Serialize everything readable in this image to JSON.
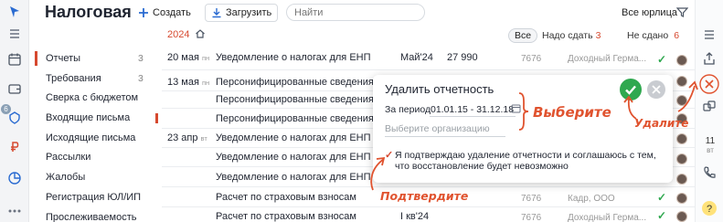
{
  "app": {
    "title": "Налоговая"
  },
  "header": {
    "create_label": "Создать",
    "upload_label": "Загрузить",
    "search_placeholder": "Найти",
    "filter_label": "Все юрлица",
    "corner_text": "ГС"
  },
  "toolbar2": {
    "year": "2024",
    "tab_all": "Все",
    "tab_todo": "Надо сдать",
    "tab_todo_count": "3",
    "tab_notdone": "Не сдано",
    "tab_notdone_count": "6"
  },
  "rail": {
    "badge": "6"
  },
  "sidebar": {
    "items": [
      {
        "label": "Отчеты",
        "count": "3"
      },
      {
        "label": "Требования",
        "count": "3"
      },
      {
        "label": "Сверка с бюджетом",
        "count": ""
      },
      {
        "label": "Входящие письма",
        "count": ""
      },
      {
        "label": "Исходящие письма",
        "count": ""
      },
      {
        "label": "Рассылки",
        "count": ""
      },
      {
        "label": "Жалобы",
        "count": ""
      },
      {
        "label": "Регистрация ЮЛ/ИП",
        "count": ""
      },
      {
        "label": "Прослеживаемость",
        "count": ""
      }
    ]
  },
  "table": {
    "rows": [
      {
        "date": "20 мая",
        "weekday": "пн",
        "name": "Уведомление о налогах для ЕНП",
        "period": "Май'24",
        "amount": "27 990",
        "code": "7676",
        "org": "Доходный Герма..."
      },
      {
        "date": "13 мая",
        "weekday": "пн",
        "name": "Персонифицированные сведения",
        "period": "",
        "amount": "",
        "code": "",
        "org": ""
      },
      {
        "date": "",
        "weekday": "",
        "name": "Персонифицированные сведения",
        "period": "",
        "amount": "",
        "code": "",
        "org": ""
      },
      {
        "date": "",
        "weekday": "",
        "name": "Персонифицированные сведения",
        "period": "",
        "amount": "",
        "code": "",
        "org": ""
      },
      {
        "date": "23 апр",
        "weekday": "вт",
        "name": "Уведомление о налогах для ЕНП",
        "period": "",
        "amount": "",
        "code": "",
        "org": ""
      },
      {
        "date": "",
        "weekday": "",
        "name": "Уведомление о налогах для ЕНП",
        "period": "",
        "amount": "",
        "code": "",
        "org": ""
      },
      {
        "date": "",
        "weekday": "",
        "name": "Уведомление о налогах для ЕНП",
        "period": "",
        "amount": "",
        "code": "",
        "org": ""
      },
      {
        "date": "",
        "weekday": "",
        "name": "Расчет по страховым взносам",
        "period": "",
        "amount": "",
        "code": "7676",
        "org": "Кадр, ООО"
      },
      {
        "date": "",
        "weekday": "",
        "name": "Расчет по страховым взносам",
        "period": "I кв'24",
        "amount": "",
        "code": "7676",
        "org": "Доходный Герма..."
      }
    ]
  },
  "dialog": {
    "title": "Удалить отчетность",
    "period_label": "За период",
    "period_value": "01.01.15 - 31.12.18",
    "org_placeholder_a": "Выберите",
    "org_placeholder_b": " организацию",
    "confirm_text": "Я подтверждаю удаление отчетности и соглашаюсь с тем, что восстановление будет невозможно"
  },
  "annotations": {
    "select": "Выберите",
    "delete": "Удалите",
    "confirm": "Подтвердите"
  },
  "right_toolbar": {
    "date_number": "11",
    "date_weekday": "вт"
  },
  "colors": {
    "accent": "#d6492f",
    "success": "#2fa84f",
    "annotation": "#e0532f"
  }
}
